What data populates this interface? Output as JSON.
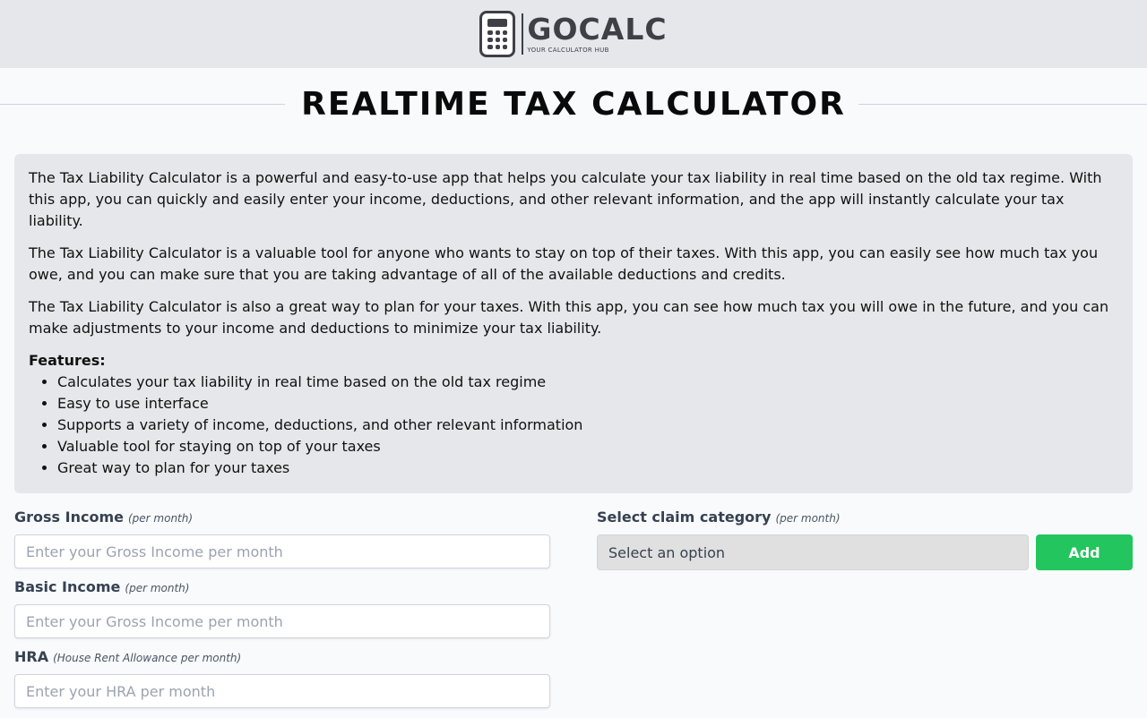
{
  "header": {
    "logo_name": "GOCALC",
    "logo_tagline": "YOUR CALCULATOR HUB",
    "logo_icon": "calculator-icon"
  },
  "page_title": "REALTIME TAX CALCULATOR",
  "description": {
    "paragraphs": [
      "The Tax Liability Calculator is a powerful and easy-to-use app that helps you calculate your tax liability in real time based on the old tax regime. With this app, you can quickly and easily enter your income, deductions, and other relevant information, and the app will instantly calculate your tax liability.",
      "The Tax Liability Calculator is a valuable tool for anyone who wants to stay on top of their taxes. With this app, you can easily see how much tax you owe, and you can make sure that you are taking advantage of all of the available deductions and credits.",
      "The Tax Liability Calculator is also a great way to plan for your taxes. With this app, you can see how much tax you will owe in the future, and you can make adjustments to your income and deductions to minimize your tax liability."
    ],
    "features_title": "Features:",
    "features": [
      "Calculates your tax liability in real time based on the old tax regime",
      "Easy to use interface",
      "Supports a variety of income, deductions, and other relevant information",
      "Valuable tool for staying on top of your taxes",
      "Great way to plan for your taxes"
    ]
  },
  "form": {
    "gross_income": {
      "label": "Gross Income",
      "hint": "(per month)",
      "value": "",
      "placeholder": "Enter your Gross Income per month"
    },
    "basic_income": {
      "label": "Basic Income",
      "hint": "(per month)",
      "value": "",
      "placeholder": "Enter your Gross Income per month"
    },
    "hra": {
      "label": "HRA",
      "hint": "(House Rent Allowance per month)",
      "value": "",
      "placeholder": "Enter your HRA per month"
    },
    "claim": {
      "label": "Select claim category",
      "hint": "(per month)",
      "selected": "Select an option",
      "add_label": "Add"
    }
  },
  "colors": {
    "topbar_bg": "#e5e7eb",
    "panel_bg": "#e5e7eb",
    "add_button": "#22c55e",
    "page_bg": "#f8fafc"
  }
}
